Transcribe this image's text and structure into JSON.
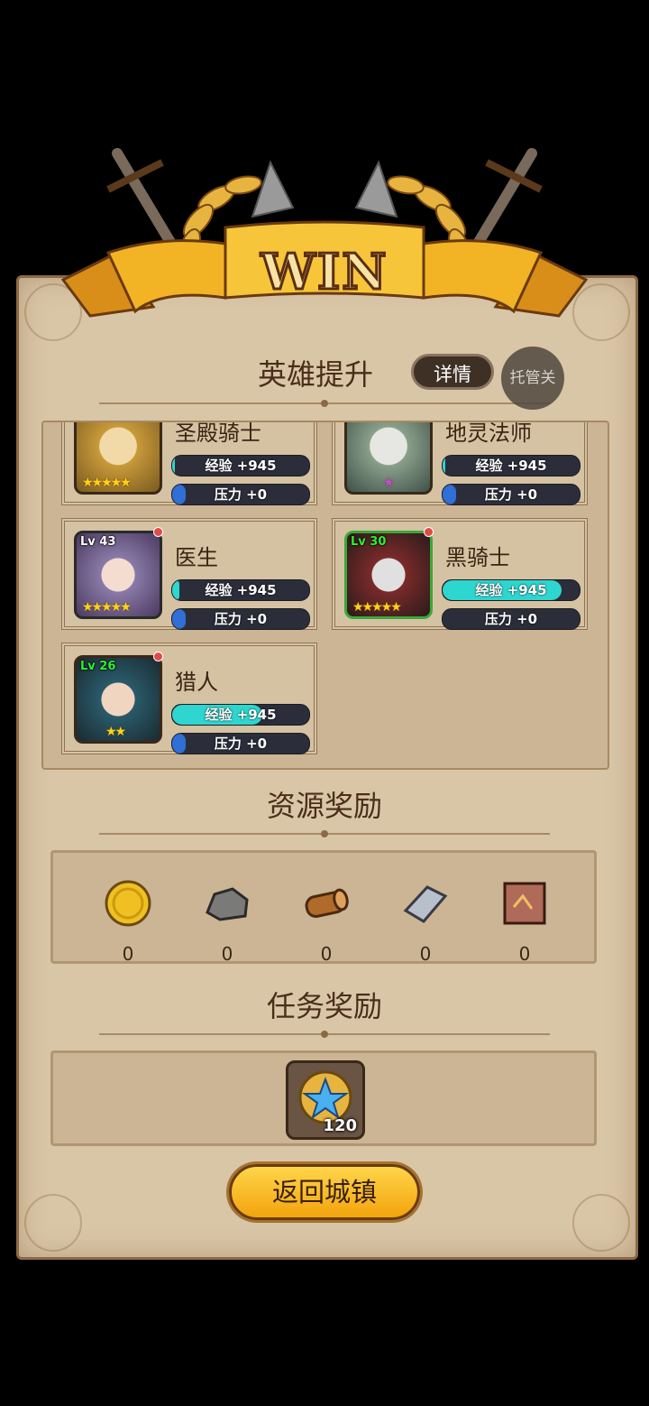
{
  "banner": {
    "title": "WIN"
  },
  "hero_section": {
    "title": "英雄提升",
    "detail_button": "详情",
    "auto_button": "托管关"
  },
  "heroes": [
    {
      "name": "圣殿骑士",
      "level": "",
      "stars": 5,
      "exp_label": "经验 +945",
      "exp_fill": 0.0,
      "stress_label": "压力 +0",
      "stress_fill": 0.1
    },
    {
      "name": "地灵法师",
      "level": "",
      "stars": 0,
      "exp_label": "经验 +945",
      "exp_fill": 0.0,
      "stress_label": "压力 +0",
      "stress_fill": 0.1
    },
    {
      "name": "医生",
      "level": "Lv 43",
      "stars": 5,
      "exp_label": "经验 +945",
      "exp_fill": 0.03,
      "stress_label": "压力 +0",
      "stress_fill": 0.1
    },
    {
      "name": "黑骑士",
      "level": "Lv 30",
      "stars": 5,
      "exp_label": "经验 +945",
      "exp_fill": 0.87,
      "stress_label": "压力 +0",
      "stress_fill": 0.0
    },
    {
      "name": "猎人",
      "level": "Lv 26",
      "stars": 2,
      "exp_label": "经验 +945",
      "exp_fill": 0.66,
      "stress_label": "压力 +0",
      "stress_fill": 0.1
    }
  ],
  "resource_section": {
    "title": "资源奖励",
    "items": [
      {
        "icon": "gold-coin-icon",
        "count": "0"
      },
      {
        "icon": "stone-icon",
        "count": "0"
      },
      {
        "icon": "wood-log-icon",
        "count": "0"
      },
      {
        "icon": "iron-ingot-icon",
        "count": "0"
      },
      {
        "icon": "leather-icon",
        "count": "0"
      }
    ]
  },
  "mission_section": {
    "title": "任务奖励",
    "item": {
      "icon": "star-medal-icon",
      "count": "120"
    }
  },
  "return_button": "返回城镇",
  "colors": {
    "parchment": "#d9c6a7",
    "exp_bar": "#2ed6d0",
    "stress_bar": "#2f6fd6",
    "button_gold": "#f2a40c"
  }
}
